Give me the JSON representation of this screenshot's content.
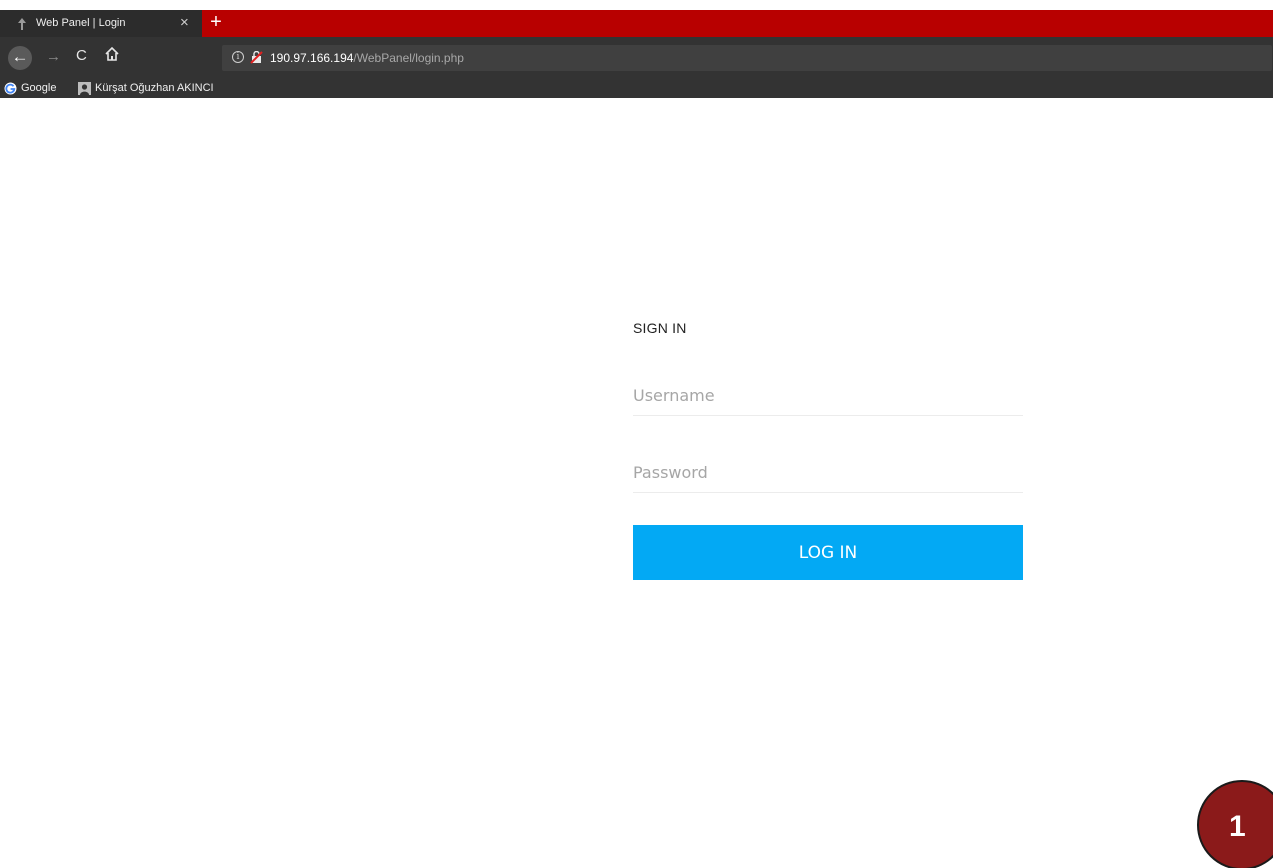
{
  "browser": {
    "tab_title": "Web Panel | Login",
    "tab_close": "×",
    "new_tab": "+",
    "nav": {
      "back": "←",
      "forward": "→",
      "reload": "C"
    },
    "url": {
      "host": "190.97.166.194",
      "path": "/WebPanel/login.php"
    },
    "bookmarks": [
      {
        "label": "Google"
      },
      {
        "label": "Kürşat Oğuzhan AKINCI"
      }
    ],
    "colors": {
      "tab_strip": "#b80000",
      "toolbar": "#333333"
    }
  },
  "login": {
    "heading": "SIGN IN",
    "username_placeholder": "Username",
    "password_placeholder": "Password",
    "submit_label": "LOG IN",
    "accent": "#03a9f4"
  },
  "badge": {
    "number": "1"
  }
}
